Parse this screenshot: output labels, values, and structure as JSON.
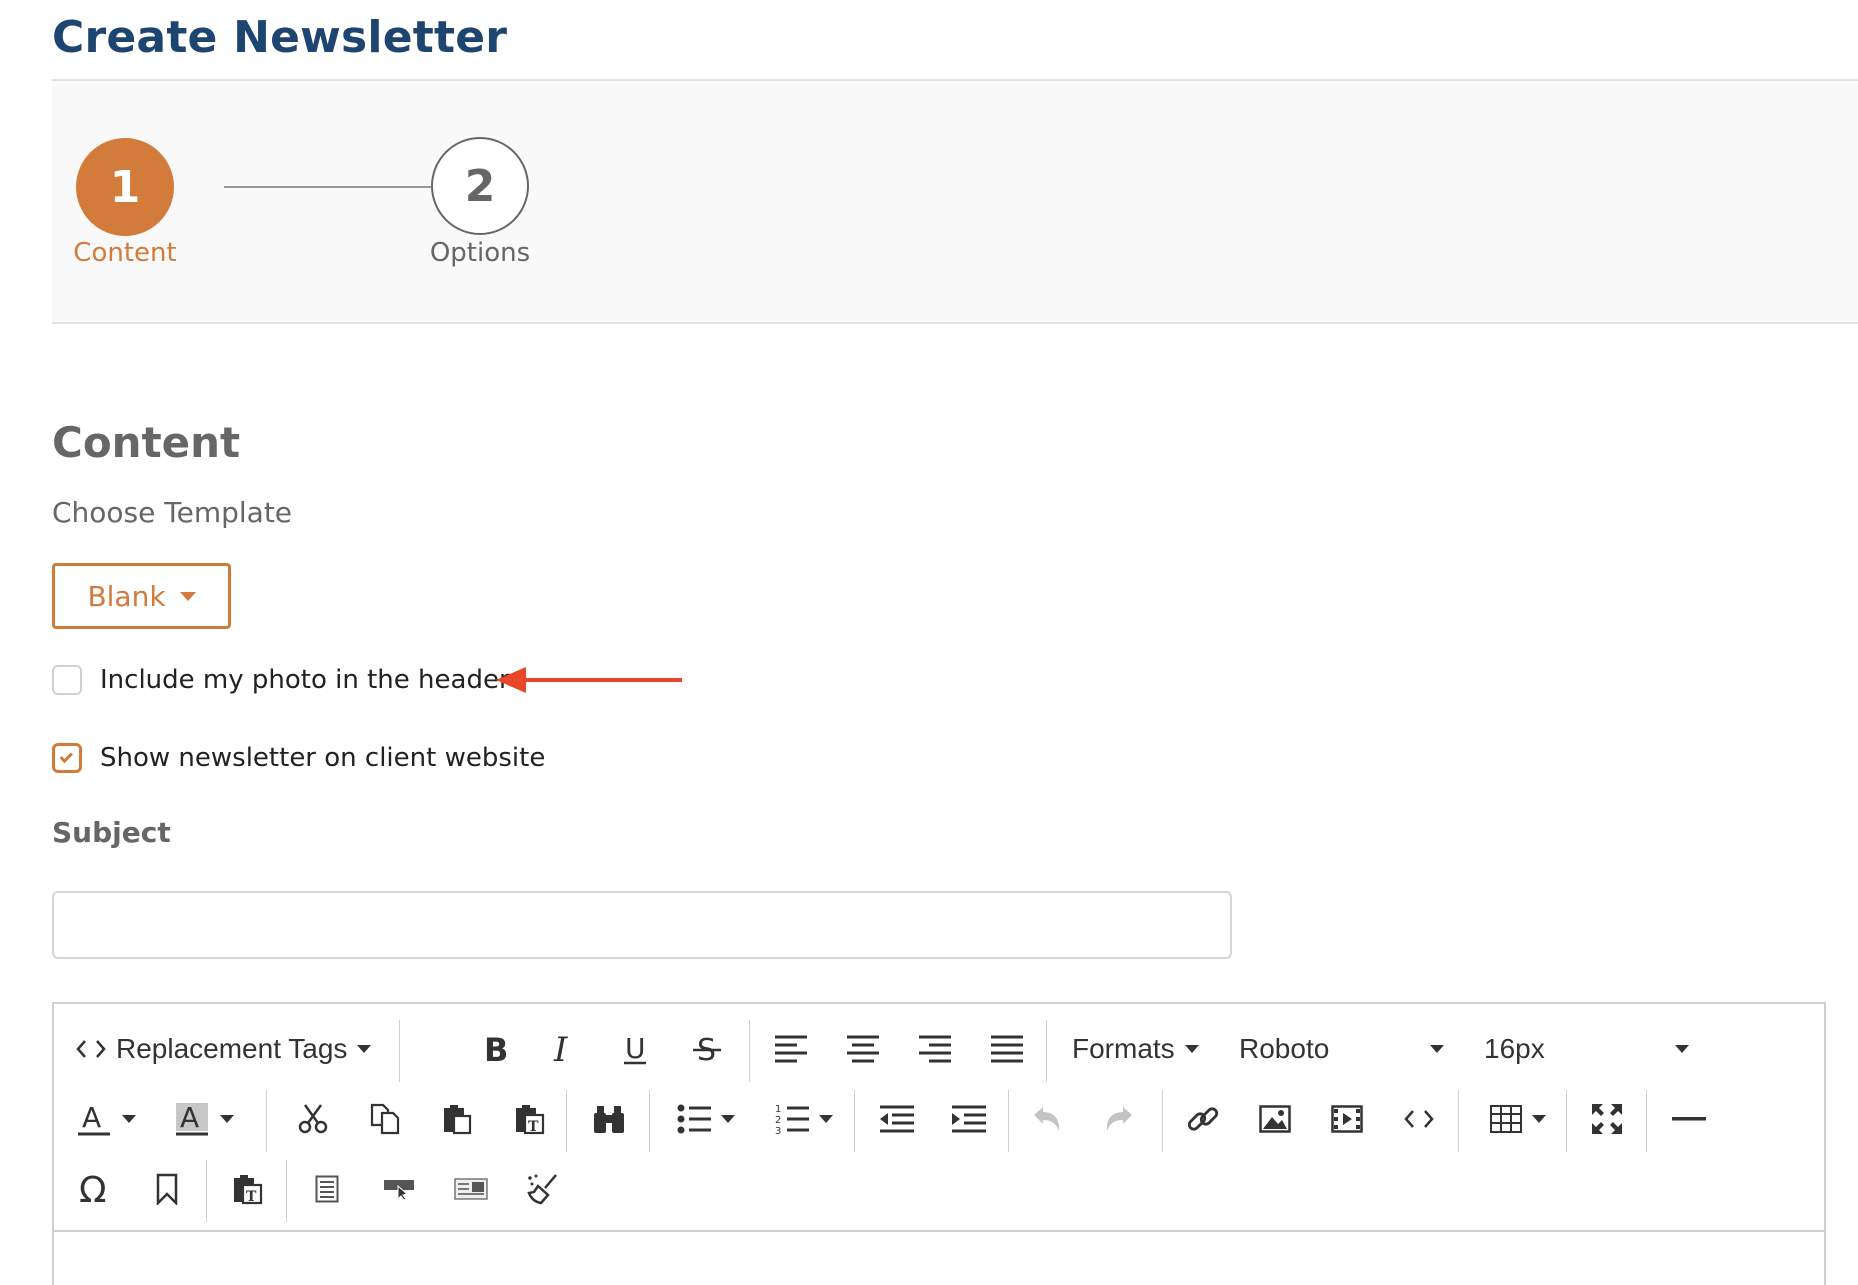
{
  "page": {
    "title": "Create Newsletter"
  },
  "stepper": {
    "steps": [
      {
        "number": "1",
        "label": "Content",
        "state": "active"
      },
      {
        "number": "2",
        "label": "Options",
        "state": "inactive"
      }
    ],
    "active_color": "#d27b3a"
  },
  "content": {
    "section_title": "Content",
    "choose_template_label": "Choose Template",
    "template_value": "Blank",
    "checkboxes": [
      {
        "label": "Include my photo in the header",
        "checked": false
      },
      {
        "label": "Show newsletter on client website",
        "checked": true
      }
    ],
    "subject_label": "Subject",
    "subject_value": "",
    "annotation_arrow_color": "#e8472b"
  },
  "editor": {
    "toolbar": {
      "replacement_tags_label": "Replacement Tags",
      "formats_label": "Formats",
      "font_family_value": "Roboto",
      "font_size_value": "16px"
    }
  }
}
